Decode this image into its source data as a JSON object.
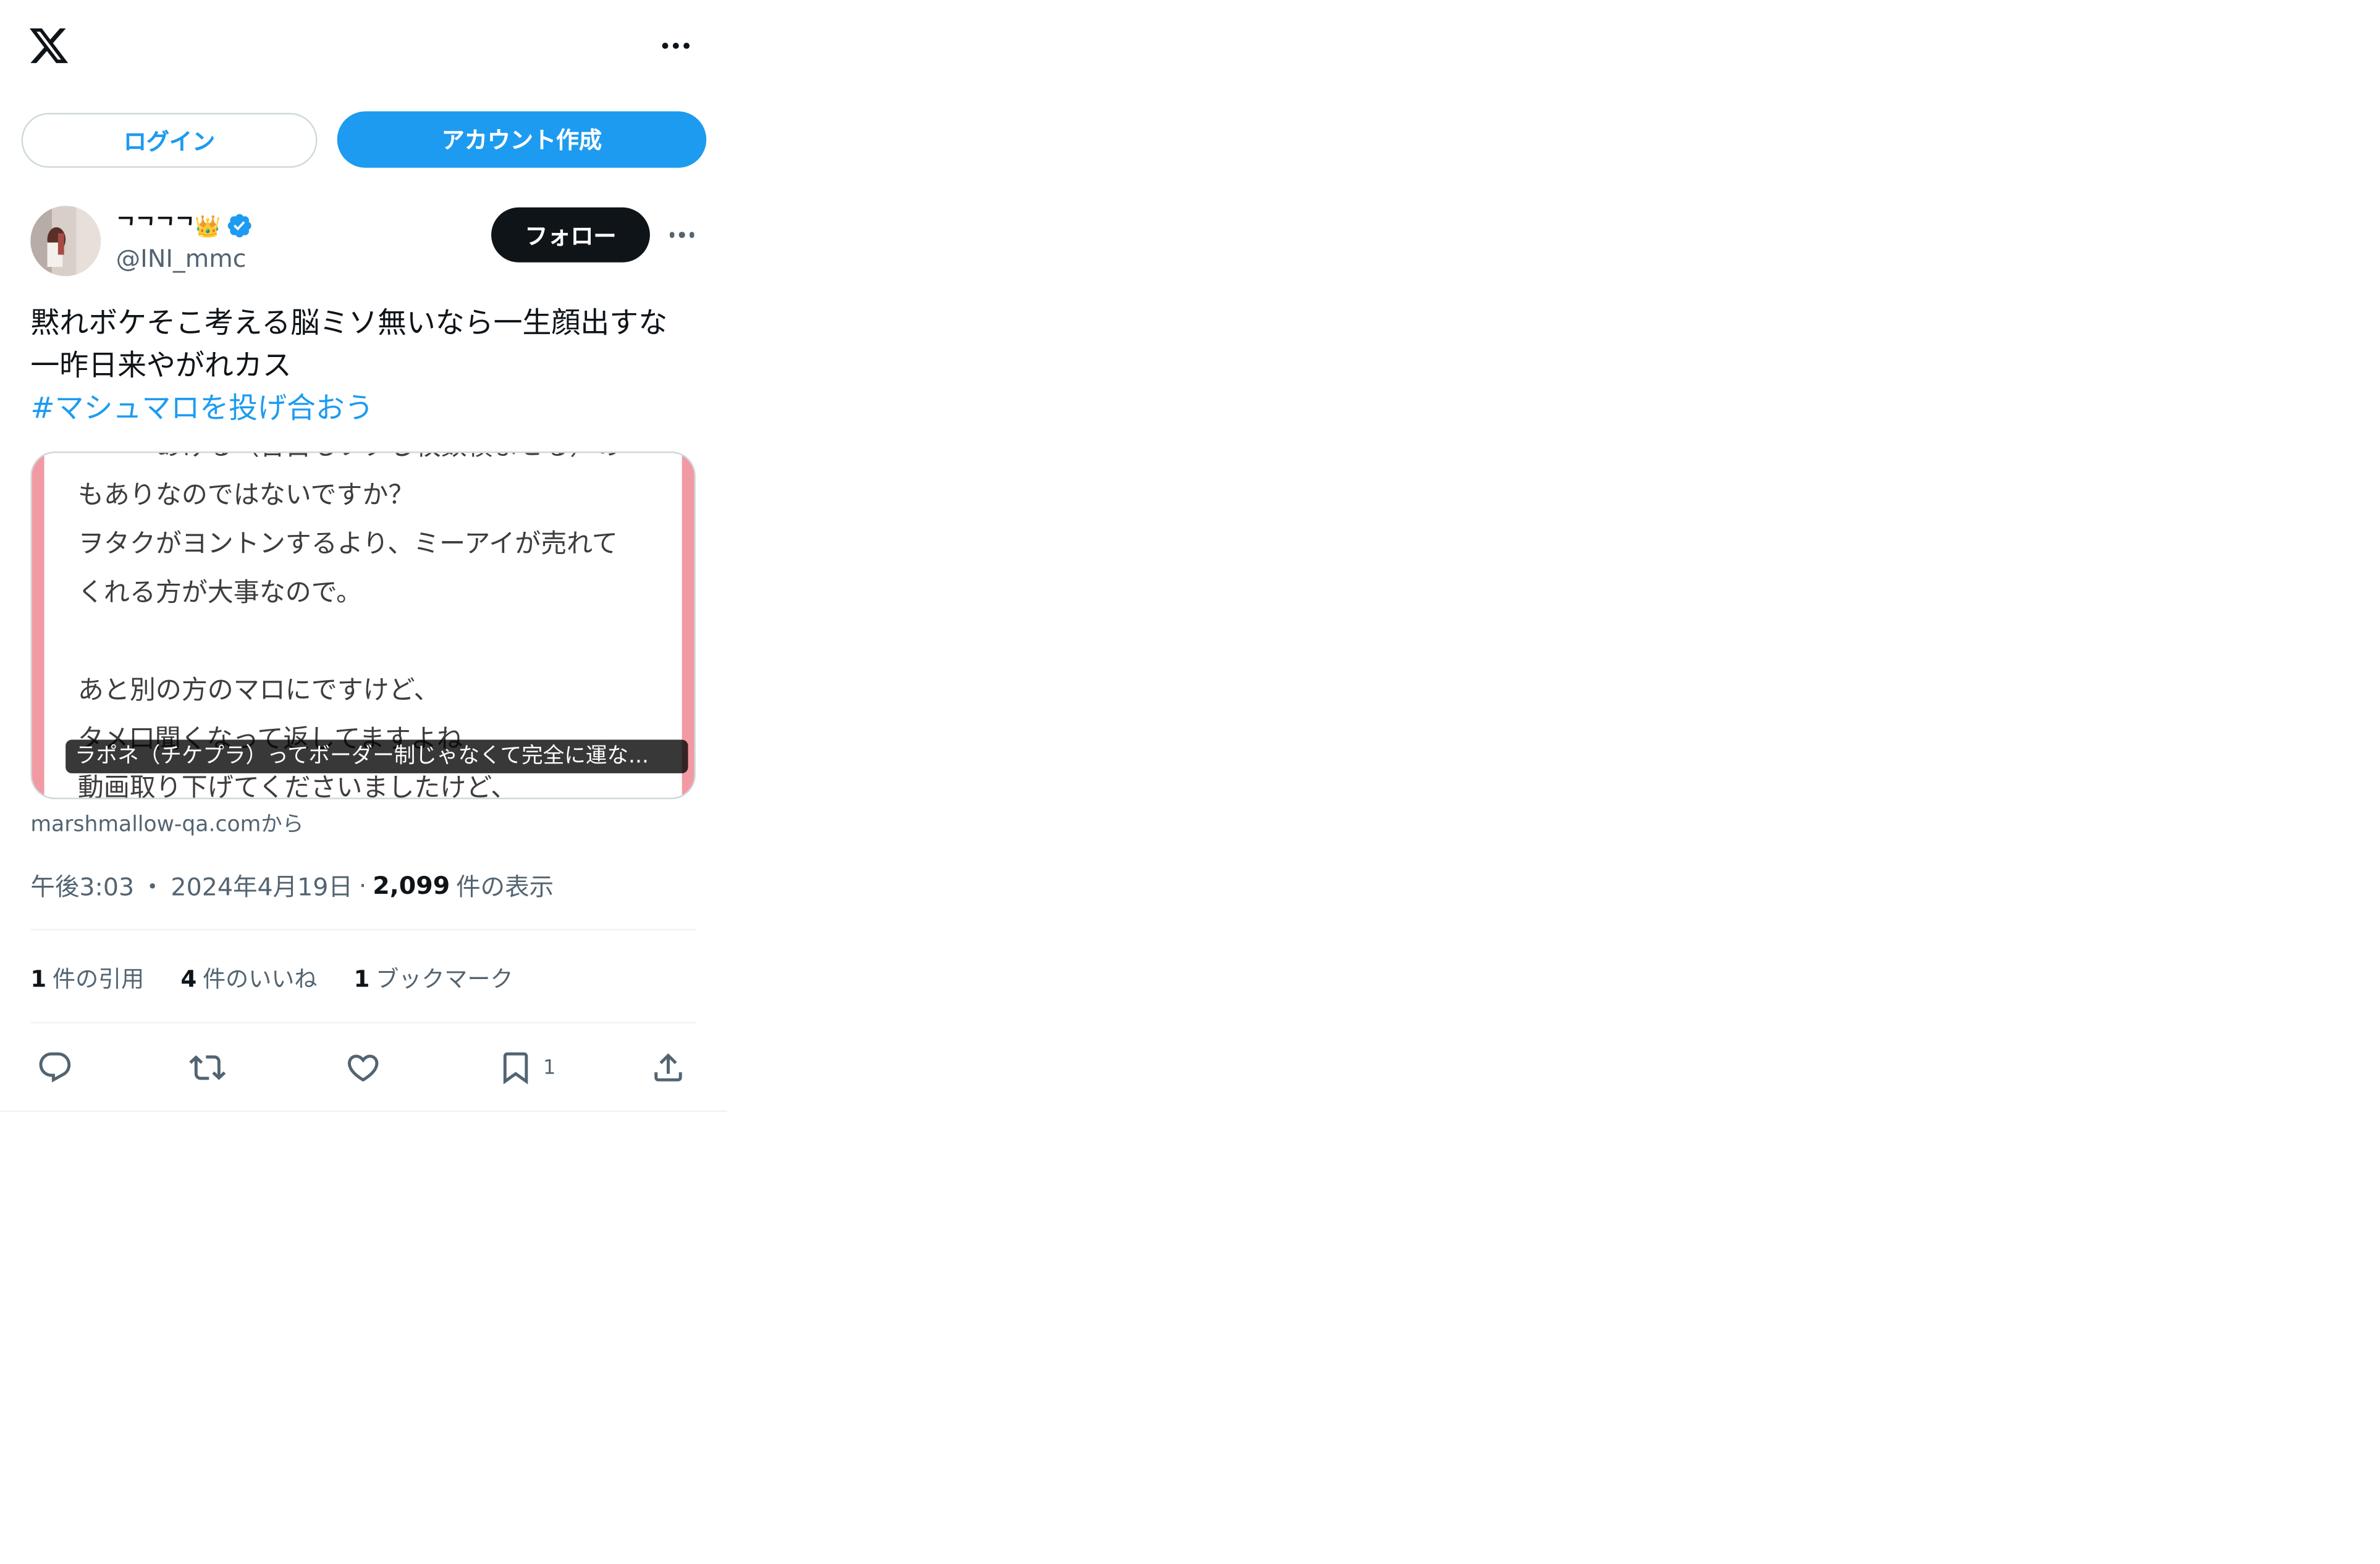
{
  "header": {
    "logo_icon": "x-logo-icon",
    "more_icon": "more-horizontal-icon"
  },
  "auth": {
    "login_label": "ログイン",
    "signup_label": "アカウント作成"
  },
  "tweet": {
    "display_name": "ᄀᄀᄀᄀ👑",
    "verified_icon": "verified-badge-icon",
    "handle": "@INI_mmc",
    "follow_label": "フォロー",
    "text_line1": "黙れボケそこ考える脳ミソ無いなら一生顔出すな",
    "text_line2": "一昨日来やがれカス",
    "hashtag": "#マシュマロを投げ合おう",
    "card": {
      "body_text": "ー〜ーあげる（合目もフタし枚数積ませる）の\nもありなのではないですか？\nヲタクがヨントンするより、ミーアイが売れて\nくれる方が大事なので。\n\nあと別の方のマロにですけど、\nタメ口聞くなって返してますよね\n動画取り下げてくださいましたけど、",
      "caption": "ラポネ（チケプラ）ってボーダー制じゃなくて完全に運な..."
    },
    "source": "marshmallow-qa.comから",
    "time": "午後3:03",
    "date": "2024年4月19日",
    "views_count": "2,099",
    "views_label": "件の表示",
    "stats": {
      "quotes_count": "1",
      "quotes_label": "件の引用",
      "likes_count": "4",
      "likes_label": "件のいいね",
      "bookmarks_count": "1",
      "bookmarks_label": "ブックマーク"
    },
    "actions": {
      "bookmark_count": "1"
    }
  },
  "colors": {
    "accent": "#1d9bf0",
    "text": "#0f1419",
    "secondary": "#536471",
    "card_border": "#f29aa3"
  }
}
